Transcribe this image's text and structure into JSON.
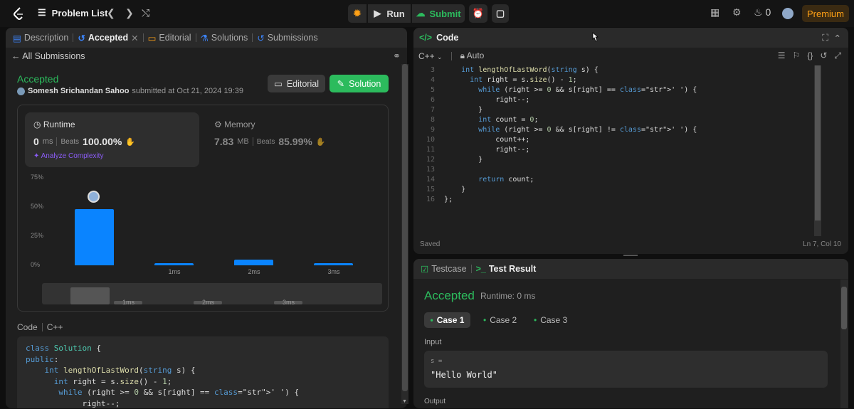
{
  "topbar": {
    "problem_list": "Problem List",
    "run": "Run",
    "submit": "Submit",
    "streak": "0",
    "premium": "Premium"
  },
  "left_tabs": {
    "description": "Description",
    "accepted": "Accepted",
    "editorial": "Editorial",
    "solutions": "Solutions",
    "submissions": "Submissions"
  },
  "submission": {
    "all_submissions": "All Submissions",
    "status": "Accepted",
    "user": "Somesh Srichandan Sahoo",
    "submitted_at": "submitted at Oct 21, 2024 19:39",
    "editorial_btn": "Editorial",
    "solution_btn": "Solution"
  },
  "runtime": {
    "label": "Runtime",
    "value": "0",
    "unit": "ms",
    "beats_label": "Beats",
    "beats": "100.00%",
    "analyze": "Analyze Complexity"
  },
  "memory": {
    "label": "Memory",
    "value": "7.83",
    "unit": "MB",
    "beats_label": "Beats",
    "beats": "85.99%"
  },
  "chart_data": {
    "type": "bar",
    "categories": [
      "",
      "1ms",
      "2ms",
      "3ms"
    ],
    "values": [
      48,
      2,
      5,
      2
    ],
    "ylabels": [
      "75%",
      "50%",
      "25%",
      "0%"
    ],
    "ylim": [
      0,
      75
    ],
    "mini_labels": [
      "1ms",
      "2ms",
      "3ms"
    ]
  },
  "code_section": {
    "label": "Code",
    "lang": "C++",
    "lines": [
      "class Solution {",
      "public:",
      "    int lengthOfLastWord(string s) {",
      "      int right = s.size() - 1;",
      "       while (right >= 0 && s[right] == ' ') {",
      "            right--;"
    ]
  },
  "editor": {
    "title": "Code",
    "lang": "C++",
    "auto": "Auto",
    "saved": "Saved",
    "cursor": "Ln 7, Col 10",
    "line_numbers": [
      "3",
      "4",
      "5",
      "6",
      "7",
      "8",
      "9",
      "10",
      "11",
      "12",
      "13",
      "14",
      "15",
      "16"
    ],
    "lines": [
      "    int lengthOfLastWord(string s) {",
      "      int right = s.size() - 1;",
      "        while (right >= 0 && s[right] == ' ') {",
      "            right--;",
      "        }",
      "        int count = 0;",
      "        while (right >= 0 && s[right] != ' ') {",
      "            count++;",
      "            right--;",
      "        }",
      "",
      "        return count;",
      "    }",
      "};"
    ]
  },
  "test": {
    "testcase_tab": "Testcase",
    "result_tab": "Test Result",
    "status": "Accepted",
    "runtime": "Runtime: 0 ms",
    "cases": [
      "Case 1",
      "Case 2",
      "Case 3"
    ],
    "input_label": "Input",
    "var": "s =",
    "value": "\"Hello World\"",
    "output_label": "Output"
  },
  "colors": {
    "accent_green": "#2cbb5d",
    "bar_blue": "#0a84ff",
    "premium": "#ffa116"
  }
}
